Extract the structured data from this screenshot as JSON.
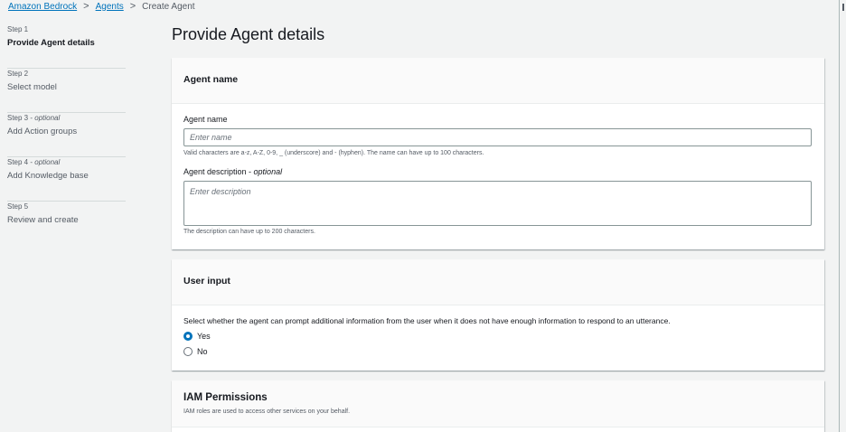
{
  "breadcrumb": {
    "items": [
      "Amazon Bedrock",
      "Agents"
    ],
    "current": "Create Agent",
    "separator": ">"
  },
  "sidebar": {
    "steps": [
      {
        "number": "Step 1",
        "optional": "",
        "title": "Provide Agent details",
        "active": true
      },
      {
        "number": "Step 2",
        "optional": "",
        "title": "Select model",
        "active": false
      },
      {
        "number": "Step 3 - ",
        "optional": "optional",
        "title": "Add Action groups",
        "active": false
      },
      {
        "number": "Step 4 - ",
        "optional": "optional",
        "title": "Add Knowledge base",
        "active": false
      },
      {
        "number": "Step 5",
        "optional": "",
        "title": "Review and create",
        "active": false
      }
    ]
  },
  "page": {
    "title": "Provide Agent details"
  },
  "agent_name_panel": {
    "title": "Agent name",
    "name_label": "Agent name",
    "name_placeholder": "Enter name",
    "name_value": "",
    "name_hint": "Valid characters are a-z, A-Z, 0-9, _ (underscore) and - (hyphen). The name can have up to 100 characters.",
    "description_label": "Agent description - ",
    "description_optional": "optional",
    "description_placeholder": "Enter description",
    "description_value": "",
    "description_hint": "The description can have up to 200 characters."
  },
  "user_input_panel": {
    "title": "User input",
    "description": "Select whether the agent can prompt additional information from the user when it does not have enough information to respond to an utterance.",
    "options": [
      {
        "label": "Yes",
        "checked": true
      },
      {
        "label": "No",
        "checked": false
      }
    ]
  },
  "iam_panel": {
    "title": "IAM Permissions",
    "subtitle": "IAM roles are used to access other services on your behalf."
  },
  "colors": {
    "background": "#f2f3f3",
    "link": "#0073bb",
    "panel_header": "#fafafa",
    "radio_selected": "#0073bb"
  }
}
